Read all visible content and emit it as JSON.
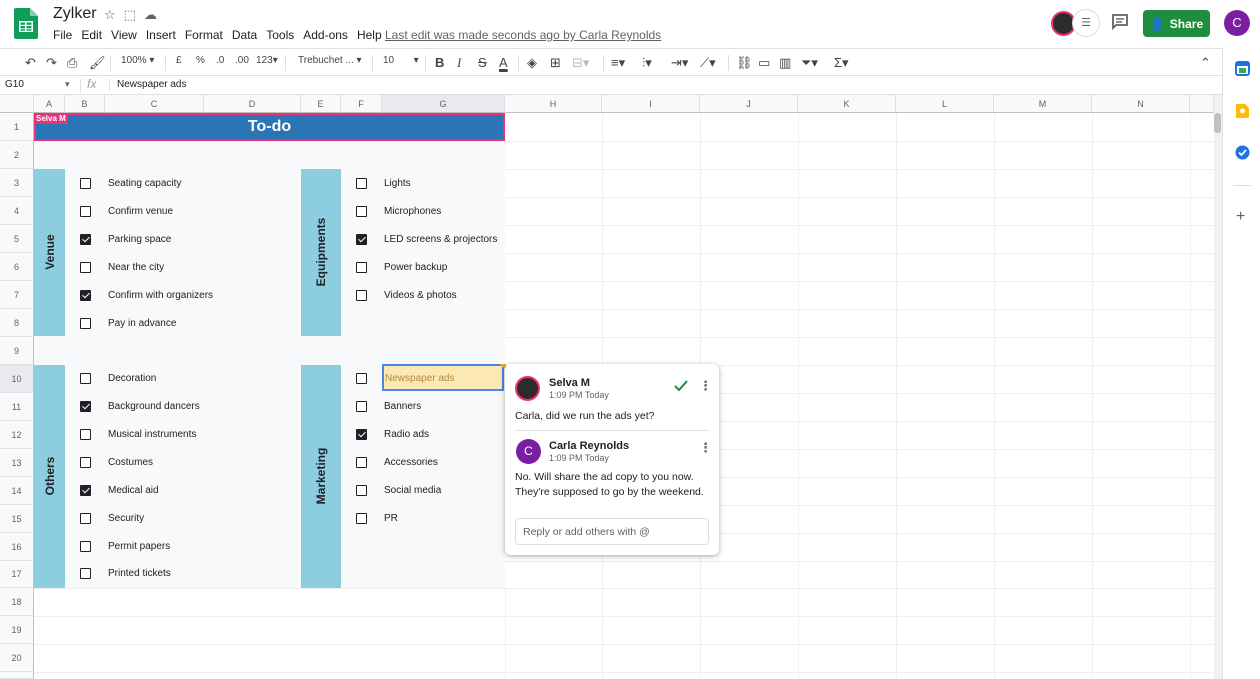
{
  "app": {
    "title": "Zylker",
    "last_edit": "Last edit was made seconds ago by Carla Reynolds",
    "menu": [
      "File",
      "Edit",
      "View",
      "Insert",
      "Format",
      "Data",
      "Tools",
      "Add-ons",
      "Help"
    ],
    "share_label": "Share",
    "account_initial": "C",
    "accent_color": "#1e8e3e"
  },
  "toolbar": {
    "zoom": "100%",
    "currency": "£",
    "percent": "%",
    "dec_decrease": ".0",
    "dec_increase": ".00",
    "more_formats": "123",
    "font": "Trebuchet ...",
    "font_size": "10",
    "bold": "B",
    "italic": "I",
    "strike": "S",
    "text_color": "A",
    "functions": "Σ"
  },
  "formula_bar": {
    "cell_ref": "G10",
    "fx": "fx",
    "value": "Newspaper ads"
  },
  "grid": {
    "columns": [
      "A",
      "B",
      "C",
      "D",
      "E",
      "F",
      "G",
      "H",
      "I",
      "J",
      "K",
      "L",
      "M",
      "N"
    ],
    "rows": [
      "1",
      "2",
      "3",
      "4",
      "5",
      "6",
      "7",
      "8",
      "9",
      "10",
      "11",
      "12",
      "13",
      "14",
      "15",
      "16",
      "17",
      "18",
      "19",
      "20"
    ]
  },
  "sheet": {
    "header": "To-do",
    "presence_tag": "Selva M",
    "header_color": "#2b74b5",
    "band_color": "#8dcde0",
    "sections": [
      {
        "label": "Venue",
        "tasks": [
          {
            "label": "Seating capacity",
            "checked": false
          },
          {
            "label": "Confirm venue",
            "checked": false
          },
          {
            "label": "Parking space",
            "checked": true
          },
          {
            "label": "Near the city",
            "checked": false
          },
          {
            "label": "Confirm with organizers",
            "checked": true
          },
          {
            "label": "Pay in advance",
            "checked": false
          }
        ]
      },
      {
        "label": "Equipments",
        "tasks": [
          {
            "label": "Lights",
            "checked": false
          },
          {
            "label": "Microphones",
            "checked": false
          },
          {
            "label": "LED screens & projectors",
            "checked": true
          },
          {
            "label": "Power backup",
            "checked": false
          },
          {
            "label": "Videos & photos",
            "checked": false
          }
        ]
      },
      {
        "label": "Others",
        "tasks": [
          {
            "label": "Decoration",
            "checked": false
          },
          {
            "label": "Background dancers",
            "checked": true
          },
          {
            "label": "Musical instruments",
            "checked": false
          },
          {
            "label": "Costumes",
            "checked": false
          },
          {
            "label": "Medical aid",
            "checked": true
          },
          {
            "label": "Security",
            "checked": false
          },
          {
            "label": "Permit papers",
            "checked": false
          },
          {
            "label": "Printed tickets",
            "checked": false
          }
        ]
      },
      {
        "label": "Marketing",
        "tasks": [
          {
            "label": "Newspaper ads",
            "checked": false
          },
          {
            "label": "Banners",
            "checked": false
          },
          {
            "label": "Radio ads",
            "checked": true
          },
          {
            "label": "Accessories",
            "checked": false
          },
          {
            "label": "Social media",
            "checked": false
          },
          {
            "label": "PR",
            "checked": false
          }
        ]
      }
    ]
  },
  "comments": {
    "thread": [
      {
        "author": "Selva M",
        "time": "1:09 PM Today",
        "text": "Carla, did we run the ads yet?"
      },
      {
        "author": "Carla Reynolds",
        "initial": "C",
        "time": "1:09 PM Today",
        "text": "No. Will share the ad copy to you now. They're supposed to go by the weekend."
      }
    ],
    "reply_placeholder": "Reply or add others with @"
  }
}
